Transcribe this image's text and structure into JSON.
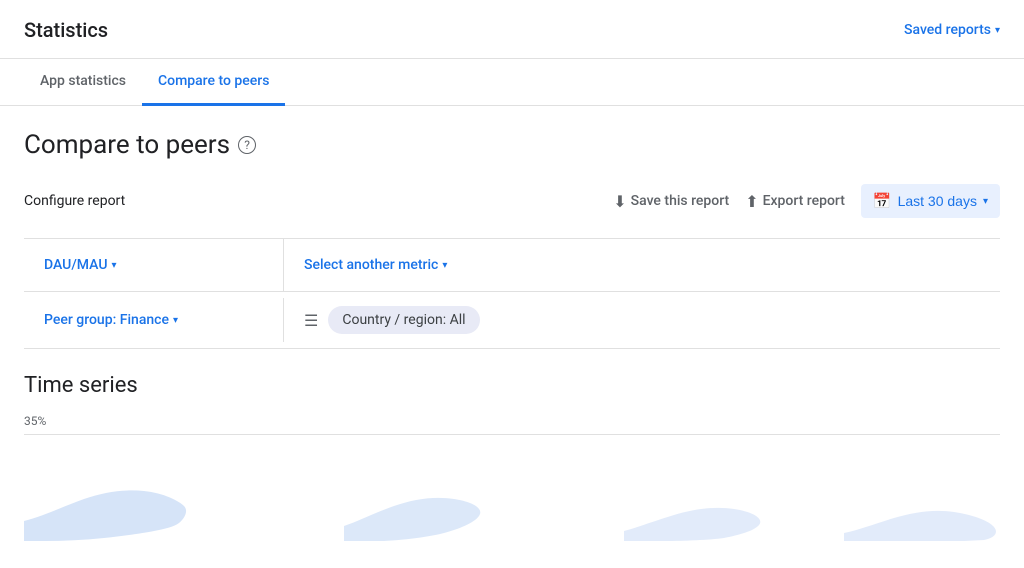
{
  "header": {
    "title": "Statistics",
    "saved_reports_label": "Saved reports"
  },
  "tabs": [
    {
      "id": "app-statistics",
      "label": "App statistics",
      "active": false
    },
    {
      "id": "compare-to-peers",
      "label": "Compare to peers",
      "active": true
    }
  ],
  "page": {
    "heading": "Compare to peers",
    "help_icon": "?",
    "configure_label": "Configure report",
    "save_report_label": "Save this report",
    "export_report_label": "Export report",
    "date_range_label": "Last 30 days"
  },
  "metrics": {
    "primary": "DAU/MAU",
    "secondary": "Select another metric"
  },
  "filters": {
    "peer_group_label": "Peer group: Finance",
    "filter_chip_label": "Country / region: All"
  },
  "time_series": {
    "title": "Time series",
    "y_label": "35%"
  },
  "colors": {
    "blue": "#1a73e8",
    "light_blue_bg": "#e8f0fe",
    "chip_bg": "#e8eaf6",
    "chart_fill": "#c5d8f5",
    "border": "#e0e0e0",
    "text_muted": "#5f6368"
  }
}
